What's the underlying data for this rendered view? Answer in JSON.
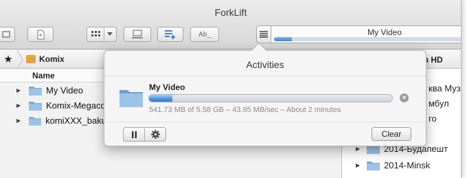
{
  "window": {
    "title": "ForkLift"
  },
  "activity_bar": {
    "title": "My Video",
    "progress": 0.097
  },
  "toolbar": {
    "rename_label": "Ab_"
  },
  "left_pane": {
    "path": "Komix",
    "column_header": "Name",
    "rows": [
      {
        "name": "My Video"
      },
      {
        "name": "Komix-Megaco"
      },
      {
        "name": "komiXXX_baku"
      }
    ]
  },
  "right_pane": {
    "path": "sh HD",
    "rows": [
      {
        "name": "ква Муз"
      },
      {
        "name": "мбул"
      },
      {
        "name": "го"
      },
      {
        "name": "2014-Будапешт"
      },
      {
        "name": "2014-Minsk"
      }
    ]
  },
  "popover": {
    "title": "Activities",
    "item": {
      "name": "My Video",
      "progress": 0.097,
      "status": "541.73 MB of 5.58 GB – 43.95 MB/sec – About 2 minutes"
    },
    "clear_label": "Clear"
  },
  "colors": {
    "progress_blue": "#4a92dd",
    "folder_blue": "#7ea9d4",
    "folder_orange": "#e6a23c"
  }
}
